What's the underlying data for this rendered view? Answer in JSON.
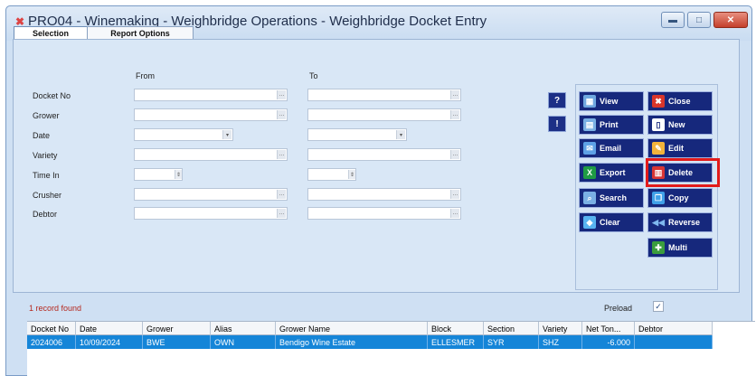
{
  "window": {
    "title": "PRO04 - Winemaking - Weighbridge Operations - Weighbridge Docket Entry",
    "title_icon": "close-x-icon",
    "controls": {
      "minimize": "minimize-icon",
      "restore": "restore-icon",
      "close": "close-icon"
    }
  },
  "tabs": [
    {
      "label": "Selection",
      "active": true
    },
    {
      "label": "Report Options",
      "active": false
    }
  ],
  "columns": {
    "from": "From",
    "to": "To"
  },
  "fields": [
    {
      "label": "Docket No",
      "from_value": "",
      "to_value": "",
      "kind": "lookup"
    },
    {
      "label": "Grower",
      "from_value": "",
      "to_value": "",
      "kind": "lookup"
    },
    {
      "label": "Date",
      "from_value": "",
      "to_value": "",
      "kind": "dropdown"
    },
    {
      "label": "Variety",
      "from_value": "",
      "to_value": "",
      "kind": "lookup"
    },
    {
      "label": "Time In",
      "from_value": "",
      "to_value": "",
      "kind": "spinner"
    },
    {
      "label": "Crusher",
      "from_value": "",
      "to_value": "",
      "kind": "lookup"
    },
    {
      "label": "Debtor",
      "from_value": "",
      "to_value": "",
      "kind": "lookup"
    }
  ],
  "help_buttons": [
    {
      "label": "?",
      "icon": "help-icon"
    },
    {
      "label": "!",
      "icon": "info-icon"
    }
  ],
  "actions": [
    {
      "label": "View",
      "icon": "view-icon",
      "color": "#6fa8e0"
    },
    {
      "label": "Close",
      "icon": "close-icon",
      "color": "#d9362b"
    },
    {
      "label": "Print",
      "icon": "print-icon",
      "color": "#7ab0e4"
    },
    {
      "label": "New",
      "icon": "new-document-icon",
      "color": "#ffffff"
    },
    {
      "label": "Email",
      "icon": "email-icon",
      "color": "#5ea1e6"
    },
    {
      "label": "Edit",
      "icon": "edit-pencil-icon",
      "color": "#f2b33b"
    },
    {
      "label": "Export",
      "icon": "excel-export-icon",
      "color": "#1f9b44"
    },
    {
      "label": "Delete",
      "icon": "delete-icon",
      "color": "#d83535"
    },
    {
      "label": "Search",
      "icon": "search-icon",
      "color": "#7ab0e4"
    },
    {
      "label": "Copy",
      "icon": "copy-icon",
      "color": "#3fa0e8"
    },
    {
      "label": "Clear",
      "icon": "clear-eraser-icon",
      "color": "#58b4f0"
    },
    {
      "label": "Reverse",
      "icon": "reverse-icon",
      "color": "#7fb8ef"
    },
    {
      "label": "Multi",
      "icon": "multi-icon",
      "color": "#3b9d3d"
    }
  ],
  "status_text": "1 record found",
  "preload": {
    "label": "Preload",
    "checked": true
  },
  "grid": {
    "headers": [
      "Docket No",
      "Date",
      "Grower",
      "Alias",
      "Grower Name",
      "Block",
      "Section",
      "Variety",
      "Net Ton...",
      "Debtor"
    ],
    "rows": [
      [
        "2024006",
        "10/09/2024",
        "BWE",
        "OWN",
        "Bendigo Wine Estate",
        "ELLESMER",
        "SYR",
        "SHZ",
        "-6.000",
        ""
      ]
    ]
  }
}
